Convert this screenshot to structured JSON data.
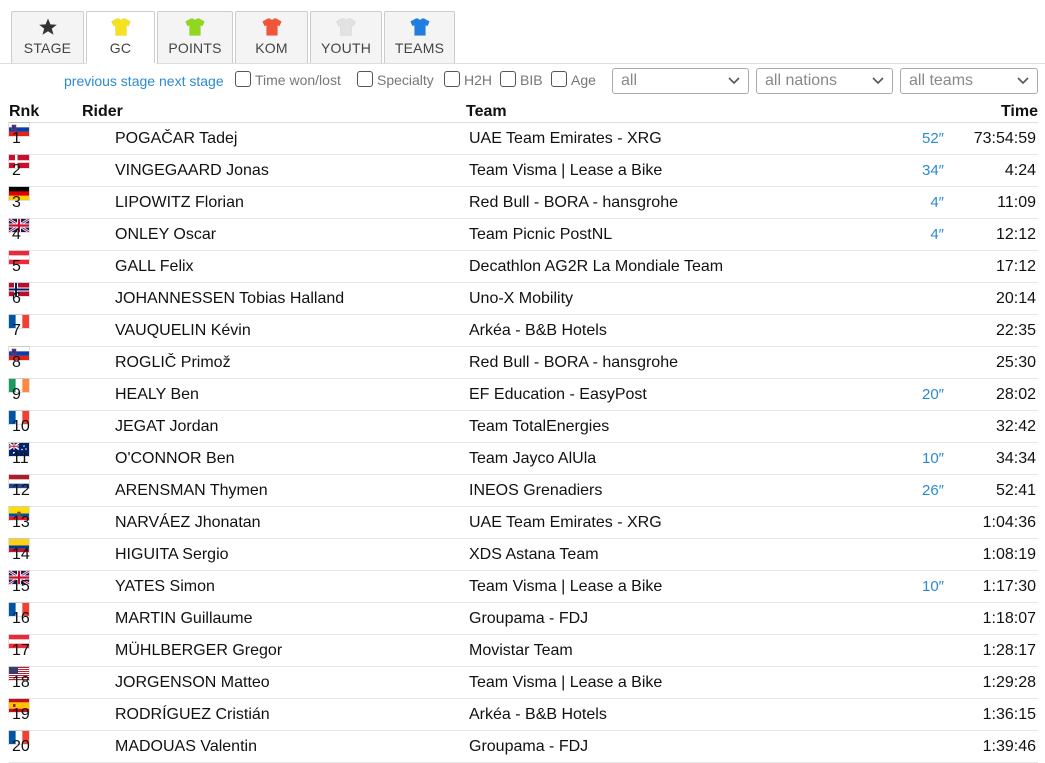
{
  "tabs": [
    {
      "label": "STAGE",
      "icon": "star-icon",
      "color": "#333333",
      "active": false
    },
    {
      "label": "GC",
      "icon": "jersey-icon",
      "color": "#f5e11d",
      "active": true
    },
    {
      "label": "POINTS",
      "icon": "jersey-icon",
      "color": "#8fd81f",
      "active": false
    },
    {
      "label": "KOM",
      "icon": "jersey-icon",
      "color": "#f2553a",
      "active": false
    },
    {
      "label": "YOUTH",
      "icon": "jersey-icon",
      "color": "#e2e2e2",
      "active": false
    },
    {
      "label": "TEAMS",
      "icon": "jersey-icon",
      "color": "#1e7fe0",
      "active": false
    }
  ],
  "controls": {
    "previous_stage": "previous stage",
    "next_stage": "next stage",
    "checkboxes": [
      "Time won/lost",
      "Specialty",
      "H2H",
      "BIB",
      "Age"
    ],
    "filters": [
      "all",
      "all nations",
      "all teams"
    ]
  },
  "columns": {
    "rank": "Rnk",
    "rider": "Rider",
    "team": "Team",
    "time": "Time"
  },
  "rows": [
    {
      "rank": "1",
      "flag": "si",
      "rider": "POGAČAR Tadej",
      "team": "UAE Team Emirates - XRG",
      "bonus": "52″",
      "time": "73:54:59"
    },
    {
      "rank": "2",
      "flag": "dk",
      "rider": "VINGEGAARD Jonas",
      "team": "Team Visma | Lease a Bike",
      "bonus": "34″",
      "time": "4:24"
    },
    {
      "rank": "3",
      "flag": "de",
      "rider": "LIPOWITZ Florian",
      "team": "Red Bull - BORA - hansgrohe",
      "bonus": "4″",
      "time": "11:09"
    },
    {
      "rank": "4",
      "flag": "gb",
      "rider": "ONLEY Oscar",
      "team": "Team Picnic PostNL",
      "bonus": "4″",
      "time": "12:12"
    },
    {
      "rank": "5",
      "flag": "at",
      "rider": "GALL Felix",
      "team": "Decathlon AG2R La Mondiale Team",
      "bonus": "",
      "time": "17:12"
    },
    {
      "rank": "6",
      "flag": "no",
      "rider": "JOHANNESSEN Tobias Halland",
      "team": "Uno-X Mobility",
      "bonus": "",
      "time": "20:14"
    },
    {
      "rank": "7",
      "flag": "fr",
      "rider": "VAUQUELIN Kévin",
      "team": "Arkéa - B&B Hotels",
      "bonus": "",
      "time": "22:35"
    },
    {
      "rank": "8",
      "flag": "si",
      "rider": "ROGLIČ Primož",
      "team": "Red Bull - BORA - hansgrohe",
      "bonus": "",
      "time": "25:30"
    },
    {
      "rank": "9",
      "flag": "ie",
      "rider": "HEALY Ben",
      "team": "EF Education - EasyPost",
      "bonus": "20″",
      "time": "28:02"
    },
    {
      "rank": "10",
      "flag": "fr",
      "rider": "JEGAT Jordan",
      "team": "Team TotalEnergies",
      "bonus": "",
      "time": "32:42"
    },
    {
      "rank": "11",
      "flag": "au",
      "rider": "O'CONNOR Ben",
      "team": "Team Jayco AlUla",
      "bonus": "10″",
      "time": "34:34"
    },
    {
      "rank": "12",
      "flag": "nl",
      "rider": "ARENSMAN Thymen",
      "team": "INEOS Grenadiers",
      "bonus": "26″",
      "time": "52:41"
    },
    {
      "rank": "13",
      "flag": "ec",
      "rider": "NARVÁEZ Jhonatan",
      "team": "UAE Team Emirates - XRG",
      "bonus": "",
      "time": "1:04:36"
    },
    {
      "rank": "14",
      "flag": "co",
      "rider": "HIGUITA Sergio",
      "team": "XDS Astana Team",
      "bonus": "",
      "time": "1:08:19"
    },
    {
      "rank": "15",
      "flag": "gb",
      "rider": "YATES Simon",
      "team": "Team Visma | Lease a Bike",
      "bonus": "10″",
      "time": "1:17:30"
    },
    {
      "rank": "16",
      "flag": "fr",
      "rider": "MARTIN Guillaume",
      "team": "Groupama - FDJ",
      "bonus": "",
      "time": "1:18:07"
    },
    {
      "rank": "17",
      "flag": "at",
      "rider": "MÜHLBERGER Gregor",
      "team": "Movistar Team",
      "bonus": "",
      "time": "1:28:17"
    },
    {
      "rank": "18",
      "flag": "us",
      "rider": "JORGENSON Matteo",
      "team": "Team Visma | Lease a Bike",
      "bonus": "",
      "time": "1:29:28"
    },
    {
      "rank": "19",
      "flag": "es",
      "rider": "RODRÍGUEZ Cristián",
      "team": "Arkéa - B&B Hotels",
      "bonus": "",
      "time": "1:36:15"
    },
    {
      "rank": "20",
      "flag": "fr",
      "rider": "MADOUAS Valentin",
      "team": "Groupama - FDJ",
      "bonus": "",
      "time": "1:39:46"
    }
  ]
}
